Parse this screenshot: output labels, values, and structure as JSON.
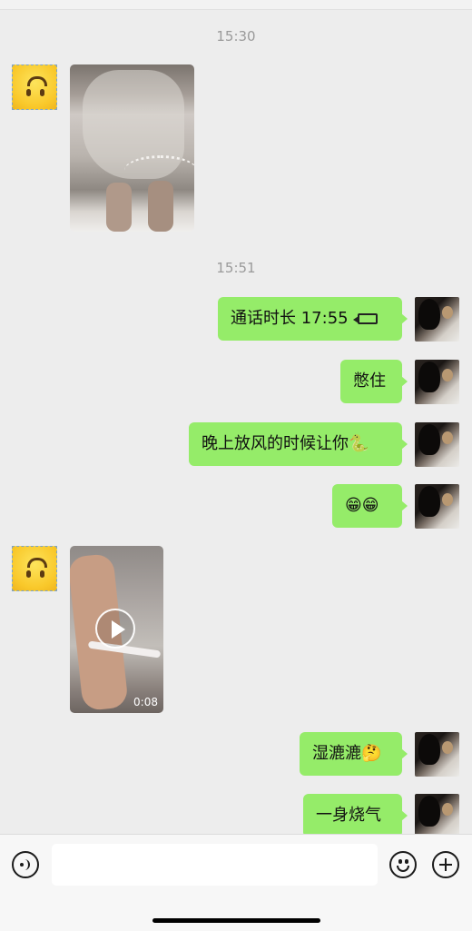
{
  "timestamps": [
    "15:30",
    "15:51"
  ],
  "messages": {
    "call": "通话时长 17:55",
    "m2": "憋住",
    "m3": "晚上放风的时候让你🐍",
    "m4": "😁😁",
    "m5": "湿漉漉🤔",
    "m6": "一身烧气"
  },
  "video": {
    "duration": "0:08"
  },
  "icons": {
    "voice": "voice-input-icon",
    "emoji": "emoji-icon",
    "plus": "plus-icon",
    "call": "video-call-icon",
    "play": "play-icon"
  },
  "colors": {
    "bubble": "#95ec69",
    "background": "#ededed"
  }
}
